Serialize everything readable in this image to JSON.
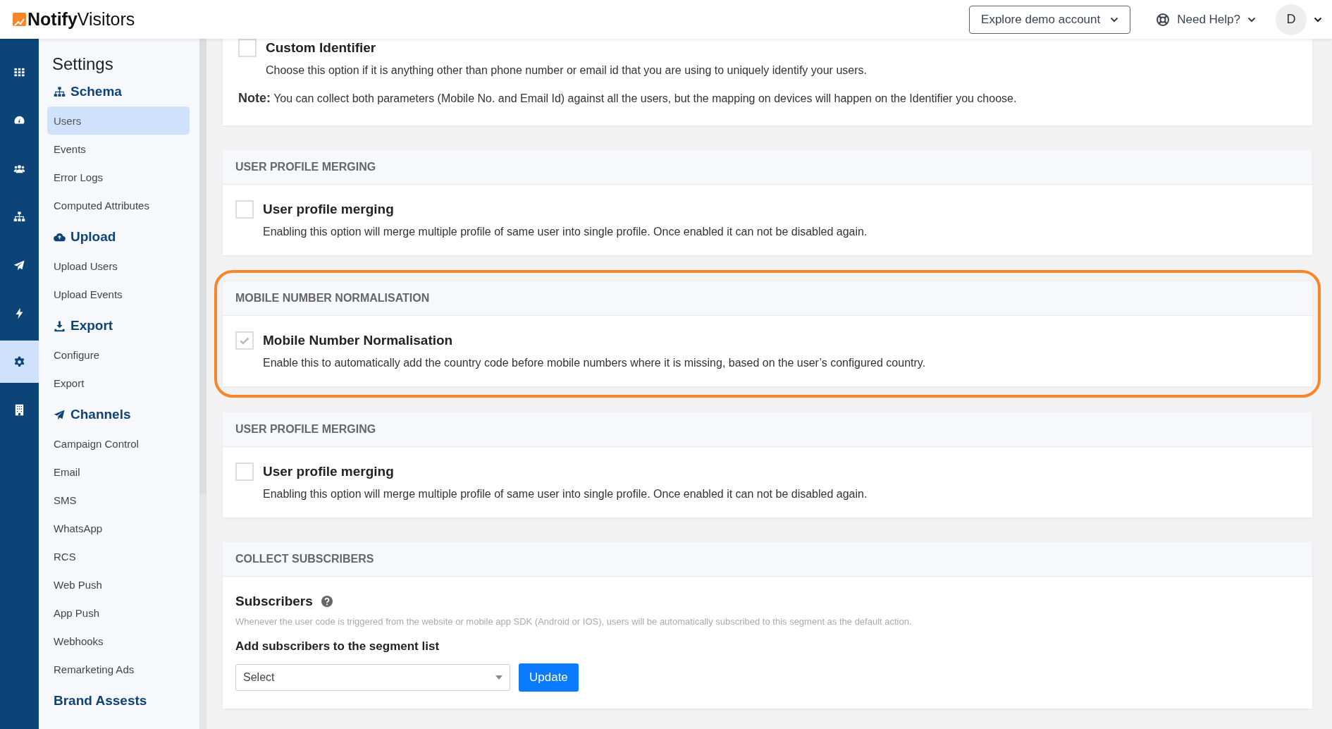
{
  "header": {
    "logo_bold": "Notify",
    "logo_rest": "Visitors",
    "demo_button": "Explore demo account",
    "help": "Need Help?",
    "avatar": "D"
  },
  "rail": [
    {
      "kind": "grid",
      "selected": false
    },
    {
      "kind": "gauge",
      "selected": false
    },
    {
      "kind": "people",
      "selected": false
    },
    {
      "kind": "tree",
      "selected": false
    },
    {
      "kind": "plane",
      "selected": false
    },
    {
      "kind": "bolt",
      "selected": false
    },
    {
      "kind": "gear",
      "selected": true
    },
    {
      "kind": "building",
      "selected": false
    }
  ],
  "sidebar": {
    "title": "Settings",
    "groups": [
      {
        "heading": "Schema",
        "kind": "tree",
        "items": [
          {
            "label": "Users",
            "selected": true
          },
          {
            "label": "Events",
            "selected": false
          },
          {
            "label": "Error Logs",
            "selected": false
          },
          {
            "label": "Computed Attributes",
            "selected": false
          }
        ]
      },
      {
        "heading": "Upload",
        "kind": "cloud",
        "items": [
          {
            "label": "Upload Users",
            "selected": false
          },
          {
            "label": "Upload Events",
            "selected": false
          }
        ]
      },
      {
        "heading": "Export",
        "kind": "download",
        "items": [
          {
            "label": "Configure",
            "selected": false
          },
          {
            "label": "Export",
            "selected": false
          }
        ]
      },
      {
        "heading": "Channels",
        "kind": "plane",
        "items": [
          {
            "label": "Campaign Control",
            "selected": false
          },
          {
            "label": "Email",
            "selected": false
          },
          {
            "label": "SMS",
            "selected": false
          },
          {
            "label": "WhatsApp",
            "selected": false
          },
          {
            "label": "RCS",
            "selected": false
          },
          {
            "label": "Web Push",
            "selected": false
          },
          {
            "label": "App Push",
            "selected": false
          },
          {
            "label": "Webhooks",
            "selected": false
          },
          {
            "label": "Remarketing Ads",
            "selected": false
          }
        ]
      },
      {
        "heading": "Brand Assests",
        "kind": "plain"
      }
    ]
  },
  "sections": [
    {
      "kind": "identifier",
      "highlighted": false,
      "label": "Custom Identifier",
      "checked": false,
      "description": "Choose this option if it is anything other than phone number or email id that you are using to uniquely identify your users.",
      "note": "**Note:** You can collect both parameters (Mobile No. and Email Id) against all the users, but the mapping on devices will happen on the Identifier you choose."
    },
    {
      "kind": "option",
      "highlighted": false,
      "title": "USER PROFILE MERGING",
      "label": "User profile merging",
      "checked": false,
      "description": "Enabling this option will merge multiple profile of same user into single profile. Once enabled it can not be disabled again."
    },
    {
      "kind": "option",
      "highlighted": true,
      "title": "MOBILE NUMBER NORMALISATION",
      "label": "Mobile Number Normalisation",
      "checked": true,
      "description": "Enable this to automatically add the country code before mobile numbers where it is missing, based on the user’s configured country."
    },
    {
      "kind": "option",
      "highlighted": false,
      "title": "USER PROFILE MERGING",
      "label": "User profile merging",
      "checked": false,
      "description": "Enabling this option will merge multiple profile of same user into single profile. Once enabled it can not be disabled again."
    },
    {
      "kind": "subscribers",
      "highlighted": false,
      "title": "COLLECT SUBSCRIBERS",
      "label": "Subscribers",
      "hint": "Whenever the user code is triggered from the website or mobile app SDK (Android or IOS), users will be automatically subscribed to this segment as the default action.",
      "field_label": "Add subscribers to the segment list",
      "select": "Select",
      "button": "Update"
    }
  ]
}
